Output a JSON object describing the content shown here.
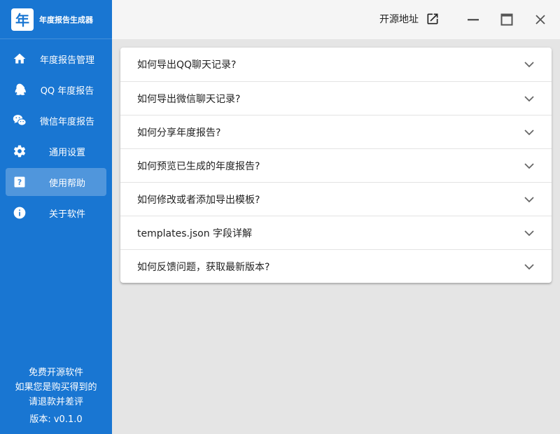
{
  "app": {
    "logo_char": "年",
    "title": "年度报告生成器"
  },
  "sidebar": {
    "items": [
      {
        "label": "年度报告管理",
        "icon": "home-icon",
        "active": false
      },
      {
        "label": "QQ 年度报告",
        "icon": "qq-penguin-icon",
        "active": false
      },
      {
        "label": "微信年度报告",
        "icon": "wechat-icon",
        "active": false
      },
      {
        "label": "通用设置",
        "icon": "gear-icon",
        "active": false
      },
      {
        "label": "使用帮助",
        "icon": "help-icon",
        "active": true
      },
      {
        "label": "关于软件",
        "icon": "info-icon",
        "active": false
      }
    ],
    "footer": {
      "line1": "免费开源软件",
      "line2": "如果您是购买得到的",
      "line3": "请退款并差评",
      "version": "版本: v0.1.0"
    }
  },
  "titlebar": {
    "source_label": "开源地址",
    "icons": [
      "open-in-new-icon",
      "minimize-icon",
      "maximize-icon",
      "close-icon"
    ]
  },
  "faq": {
    "items": [
      {
        "question": "如何导出QQ聊天记录?"
      },
      {
        "question": "如何导出微信聊天记录?"
      },
      {
        "question": "如何分享年度报告?"
      },
      {
        "question": "如何预览已生成的年度报告?"
      },
      {
        "question": "如何修改或者添加导出模板?"
      },
      {
        "question": "templates.json 字段详解"
      },
      {
        "question": "如何反馈问题，获取最新版本?"
      }
    ]
  },
  "colors": {
    "sidebar": "#1976d2",
    "titlebar": "#f5f5f5",
    "content_bg": "#e5e5e5"
  }
}
